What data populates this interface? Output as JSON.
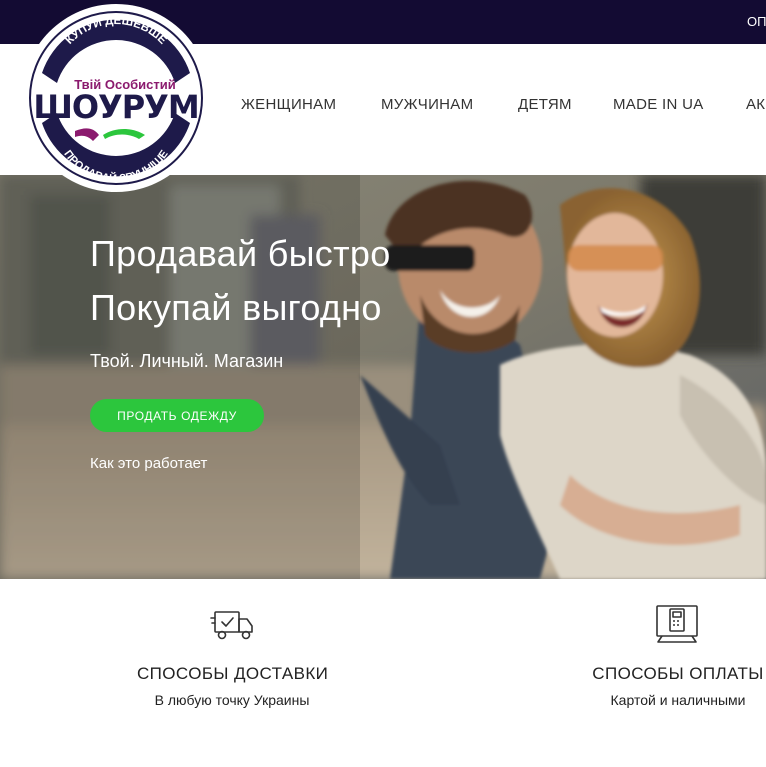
{
  "topbar": {
    "link_partial": "ОП"
  },
  "logo": {
    "arc_top": "КУПУЙ ДЕШЕВШЕ",
    "arc_bottom": "ПРОДАВАЙ ЗРУЧНІШЕ",
    "tagline": "Твій Особистий",
    "brand": "ШОУРУМ",
    "colors": {
      "navy": "#1e1a4a",
      "purple": "#8b1a6e",
      "green": "#2cc63d"
    }
  },
  "nav": {
    "items": [
      {
        "label": "ЖЕНЩИНАМ"
      },
      {
        "label": "МУЖЧИНАМ"
      },
      {
        "label": "ДЕТЯМ"
      },
      {
        "label": "MADE IN UA"
      },
      {
        "label": "АК"
      }
    ]
  },
  "hero": {
    "title_line1": "Продавай быстро",
    "title_line2": "Покупай выгодно",
    "subtitle": "Твой. Личный. Магазин",
    "cta_label": "ПРОДАТЬ ОДЕЖДУ",
    "how_it_works": "Как это работает"
  },
  "features": [
    {
      "icon": "delivery-truck-icon",
      "title": "СПОСОБЫ ДОСТАВКИ",
      "desc": "В любую точку Украины"
    },
    {
      "icon": "payment-terminal-icon",
      "title": "СПОСОБЫ ОПЛАТЫ",
      "desc": "Картой и наличными"
    }
  ],
  "colors": {
    "topbar": "#130b33",
    "cta": "#2cc63d",
    "text": "#222222"
  }
}
